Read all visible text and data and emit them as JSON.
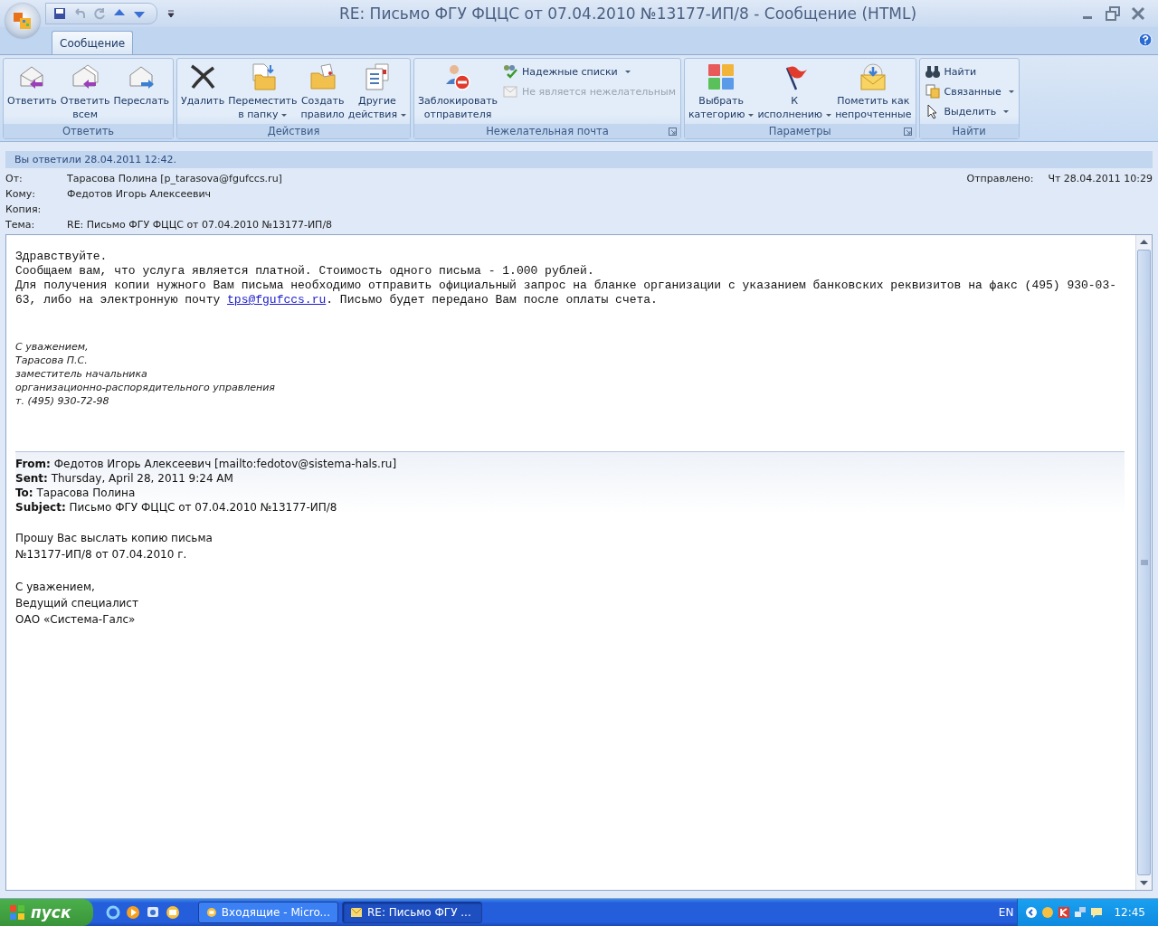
{
  "window": {
    "title": "RE: Письмо ФГУ ФЦЦС от 07.04.2010 №13177-ИП/8 - Сообщение (HTML)"
  },
  "ribbon": {
    "tabs": [
      {
        "label": "Сообщение",
        "selected": true
      }
    ],
    "groups": [
      {
        "label": "Ответить",
        "launcher": false,
        "buttons": [
          {
            "kind": "large",
            "label": "Ответить",
            "dropdown": false,
            "disabled": false
          },
          {
            "kind": "large",
            "label": "Ответить\nвсем",
            "dropdown": false,
            "disabled": false
          },
          {
            "kind": "large",
            "label": "Переслать",
            "dropdown": false,
            "disabled": false
          }
        ]
      },
      {
        "label": "Действия",
        "launcher": false,
        "buttons": [
          {
            "kind": "large",
            "label": "Удалить",
            "dropdown": false,
            "disabled": false
          },
          {
            "kind": "large",
            "label": "Переместить\nв папку",
            "dropdown": true,
            "disabled": false
          },
          {
            "kind": "large",
            "label": "Создать\nправило",
            "dropdown": false,
            "disabled": false
          },
          {
            "kind": "large",
            "label": "Другие\nдействия",
            "dropdown": true,
            "disabled": false
          }
        ]
      },
      {
        "label": "Нежелательная почта",
        "launcher": true,
        "buttons": [
          {
            "kind": "large",
            "label": "Заблокировать\nотправителя",
            "dropdown": false,
            "disabled": false
          },
          {
            "kind": "small",
            "label": "Надежные списки",
            "dropdown": true,
            "disabled": false
          },
          {
            "kind": "small",
            "label": "Не является нежелательным",
            "dropdown": false,
            "disabled": true
          }
        ]
      },
      {
        "label": "Параметры",
        "launcher": true,
        "buttons": [
          {
            "kind": "large",
            "label": "Выбрать\nкатегорию",
            "dropdown": true,
            "disabled": false
          },
          {
            "kind": "large",
            "label": "К\nисполнению",
            "dropdown": true,
            "disabled": false
          },
          {
            "kind": "large",
            "label": "Пометить как\nнепрочтенные",
            "dropdown": false,
            "disabled": false
          }
        ]
      },
      {
        "label": "Найти",
        "launcher": false,
        "buttons": [
          {
            "kind": "small",
            "label": "Найти",
            "dropdown": false,
            "disabled": false
          },
          {
            "kind": "small",
            "label": "Связанные",
            "dropdown": true,
            "disabled": false
          },
          {
            "kind": "small",
            "label": "Выделить",
            "dropdown": true,
            "disabled": false
          }
        ]
      }
    ]
  },
  "header": {
    "notice": "Вы ответили 28.04.2011 12:42.",
    "fields": [
      {
        "label": "От:",
        "value": "Тарасова Полина [p_tarasova@fgufccs.ru]"
      },
      {
        "label": "Кому:",
        "value": "Федотов Игорь Алексеевич"
      },
      {
        "label": "Копия:"
      },
      {
        "label": "Тема:",
        "value": "RE: Письмо ФГУ ФЦЦС от 07.04.2010 №13177-ИП/8"
      }
    ],
    "sent": {
      "label": "Отправлено:",
      "value": "Чт 28.04.2011 10:29"
    }
  },
  "body": {
    "lines": [
      "Здравствуйте.",
      "Сообщаем вам, что услуга является платной. Стоимость одного письма - 1.000 рублей."
    ],
    "paragraph": {
      "before": "Для получения копии нужного Вам письма необходимо отправить официальный запрос на бланке организации с указанием банковских реквизитов на факс (495) 930-03-63, либо на электронную почту ",
      "link": "tps@fgufccs.ru",
      "after": ". Письмо будет передано Вам после оплаты счета."
    },
    "signature": [
      "С уважением,",
      "Тарасова П.С.",
      "заместитель начальника",
      "организационно-распорядительного управления",
      "т. (495) 930-72-98"
    ],
    "quoted_header": [
      "**From:** Федотов Игорь Алексеевич [mailto:fedotov@sistema-hals.ru]",
      "**Sent:** Thursday, April 28, 2011 9:24 AM",
      "**To:** Тарасова Полина",
      "**Subject:** Письмо ФГУ ФЦЦС от 07.04.2010 №13177-ИП/8"
    ],
    "quoted_text": [
      [
        "Прошу Вас выслать копию письма",
        "№13177-ИП/8 от 07.04.2010 г."
      ],
      [
        "С уважением,",
        "Ведущий специалист",
        "ОАО «Система-Галс»"
      ]
    ]
  },
  "taskbar": {
    "start": "пуск",
    "tasks": [
      {
        "label": "Входящие - Micro...",
        "selected": false
      },
      {
        "label": "RE: Письмо ФГУ ...",
        "selected": true
      }
    ],
    "language": "EN",
    "clock": "12:45"
  }
}
